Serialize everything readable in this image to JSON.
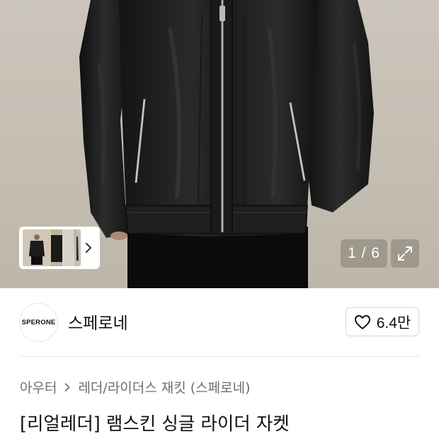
{
  "gallery": {
    "counter": "1 / 6",
    "thumbnail_count": 3,
    "next_icon": "chevron-right-icon",
    "expand_icon": "expand-arrows-icon"
  },
  "brand": {
    "logo_text": "SPERONE",
    "name": "스페로네"
  },
  "like": {
    "icon": "heart-outline-icon",
    "count": "6.4만"
  },
  "breadcrumb": {
    "items": [
      "아우터",
      "레더/라이더스 재킷 (스페로네)"
    ],
    "separator_icon": "chevron-right-icon"
  },
  "product": {
    "title": "[리얼레더] 램스킨 싱글 라이더 자켓"
  },
  "colors": {
    "photo_background": "#c4bdb2",
    "jacket": "#1a1a1a",
    "secondary_text": "#6e6e6e",
    "border": "#d8d8d8"
  }
}
